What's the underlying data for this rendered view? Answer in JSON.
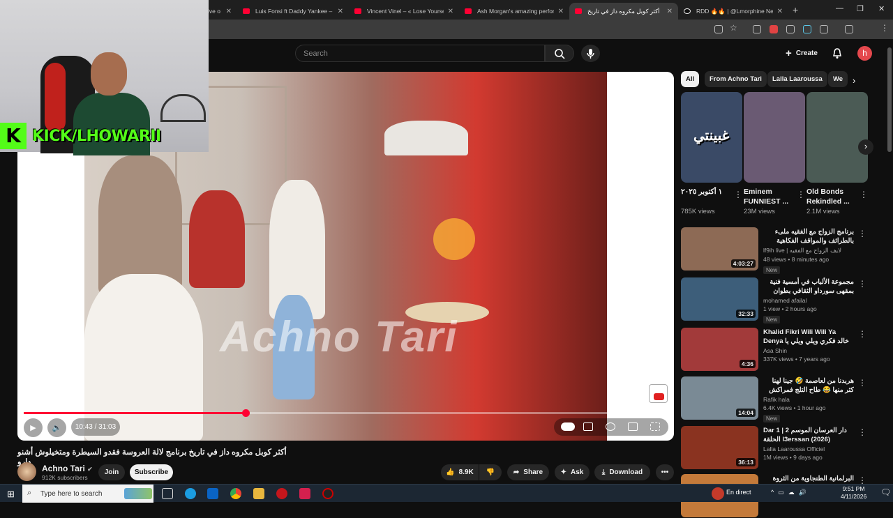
{
  "browser": {
    "tabs": [
      {
        "title": "ive o"
      },
      {
        "title": "Luis Fonsi ft Daddy Yankee – D"
      },
      {
        "title": "Vincent Vinel – « Lose Yourself"
      },
      {
        "title": "Ash Morgan's amazing perform"
      },
      {
        "title": "أكثر كوبل مكروه داز في تاريخ"
      },
      {
        "title": "RDD 🔥🔥 | @Lmorphine Next"
      }
    ],
    "profile_initial": "h"
  },
  "youtube": {
    "search_placeholder": "Search",
    "create_label": "Create",
    "user_initial": "h"
  },
  "overlay": {
    "kick_logo": "K",
    "kick_text": "KICK/LHOWARII"
  },
  "player": {
    "watermark": "Achno Tari",
    "current_time": "10:43",
    "duration": "31:03",
    "time_display": "10:43 / 31:03",
    "progress_fraction": 0.345
  },
  "video": {
    "title": "أكثر كوبل مكروه داز في تاريخ برنامج لالة العروسة فقدو السيطرة ومتخيلوش أشنو دارو",
    "channel": "Achno Tari",
    "subscribers": "912K subscribers",
    "join_label": "Join",
    "subscribe_label": "Subscribe",
    "likes": "8.9K",
    "share_label": "Share",
    "ask_label": "Ask",
    "download_label": "Download"
  },
  "chips": [
    "All",
    "From Achno Tari",
    "Lalla Laaroussa",
    "We"
  ],
  "shelf": [
    {
      "title": "١ أكتوبر ٢٠٢٥",
      "views": "785K views",
      "overlay_text": "غبينتي",
      "color": "#3a4a66"
    },
    {
      "title": "Eminem FUNNIEST ...",
      "views": "23M views",
      "color": "#6a5a73"
    },
    {
      "title": "Old Bonds Rekindled ...",
      "views": "2.1M views",
      "color": "#4b5b55"
    }
  ],
  "recommendations": [
    {
      "title": "برنامج الزواج مع الفقيه ملىء بالطرائف والمواقف الفكاهية",
      "channel": "lf9ih live | لايف الزواج مع الفقيه",
      "meta": "48 views • 8 minutes ago",
      "badge": "New",
      "duration": "4:03:27",
      "color": "#8d6a55"
    },
    {
      "title": "مجموعة الألباب في أمسية فنية بمقهى سورداو الثقافي بطوان",
      "channel": "mohamed afailal",
      "meta": "1 view • 2 hours ago",
      "badge": "New",
      "duration": "32:33",
      "color": "#3d5e7a"
    },
    {
      "title": "Khalid Fikri Wili Wili Ya Denya خالد فكري ويلي ويلي يا دنيا",
      "channel": "Asa Shin",
      "meta": "337K views • 7 years ago",
      "badge": "",
      "duration": "4:36",
      "color": "#a23a3a"
    },
    {
      "title": "هربدنا من لعاصمة 🤣 جينا لهنا كثر منها 😂 طاح التلج فمراكش ❄️",
      "channel": "Rafik hala",
      "meta": "6.4K views • 1 hour ago",
      "badge": "New",
      "duration": "14:04",
      "color": "#7a8a95"
    },
    {
      "title": "Dar 1 دار العرسان الموسم 2 | الحلقة l3erssan (2026)",
      "channel": "Lalla Laaroussa Officiel",
      "meta": "1M views • 9 days ago",
      "badge": "",
      "duration": "36:13",
      "color": "#8a3320"
    },
    {
      "title": "البرلمانية الطنجاوية من الثروة فالتيك توك",
      "channel": "",
      "meta": "",
      "badge": "",
      "duration": "",
      "color": "#c47a3a"
    }
  ],
  "taskbar": {
    "search_placeholder": "Type here to search",
    "live_label": "En direct",
    "time": "9:51 PM",
    "date": "4/11/2026"
  }
}
